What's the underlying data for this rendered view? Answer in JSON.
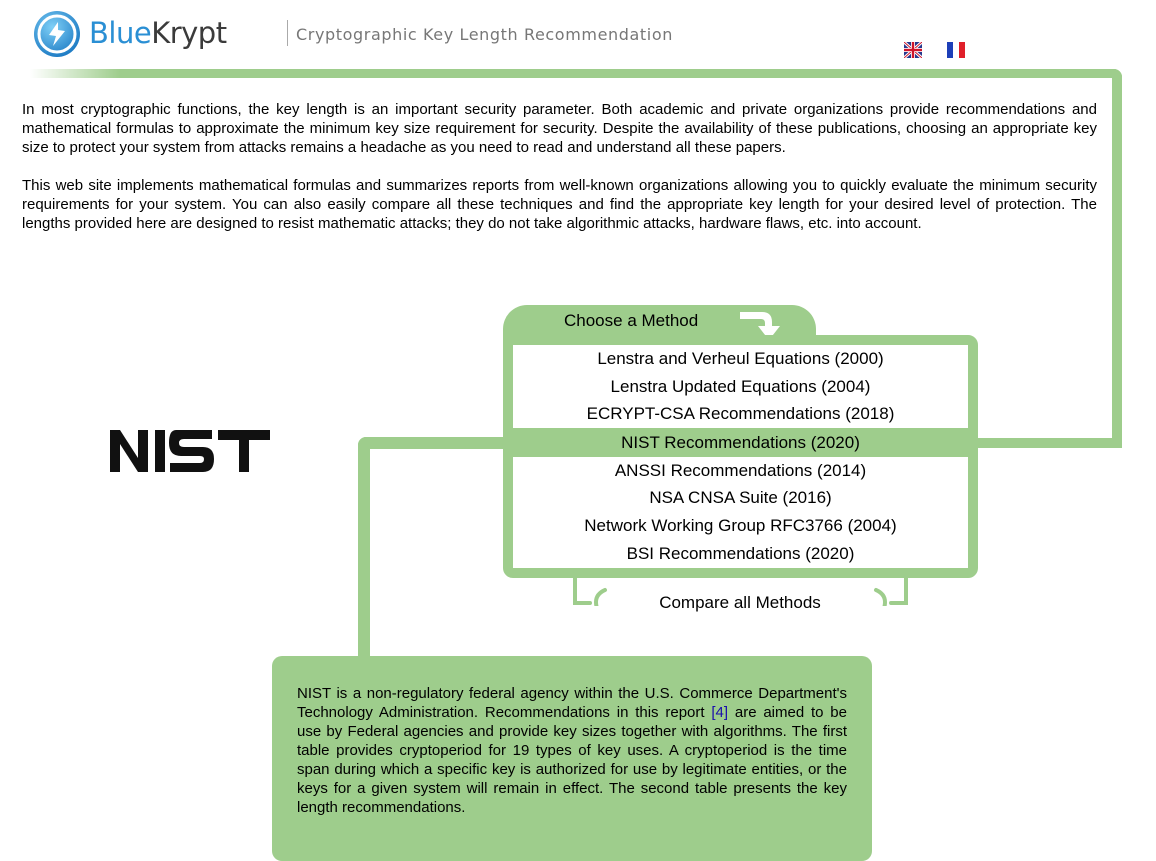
{
  "header": {
    "brand_part1": "Blue",
    "brand_part2": "Krypt",
    "tagline": "Cryptographic Key Length Recommendation"
  },
  "languages": [
    {
      "code": "en",
      "icon": "uk-flag-icon"
    },
    {
      "code": "fr",
      "icon": "france-flag-icon"
    }
  ],
  "intro": {
    "paragraph1": "In most cryptographic functions, the key length is an important security parameter. Both academic and private organizations provide recommendations and mathematical formulas to approximate the minimum key size requirement for security. Despite the availability of these publications, choosing an appropriate key size to protect your system from attacks remains a headache as you need to read and understand all these papers.",
    "paragraph2": "This web site implements mathematical formulas and summarizes reports from well-known organizations allowing you to quickly evaluate the minimum security requirements for your system. You can also easily compare all these techniques and find the appropriate key length for your desired level of protection. The lengths provided here are designed to resist mathematic attacks; they do not take algorithmic attacks, hardware flaws, etc. into account."
  },
  "selected_logo": {
    "text": "NIST"
  },
  "methods": {
    "title": "Choose a Method",
    "items": [
      {
        "label": "Lenstra and Verheul Equations (2000)",
        "active": false
      },
      {
        "label": "Lenstra Updated Equations (2004)",
        "active": false
      },
      {
        "label": "ECRYPT-CSA Recommendations (2018)",
        "active": false
      },
      {
        "label": "NIST Recommendations (2020)",
        "active": true
      },
      {
        "label": "ANSSI Recommendations (2014)",
        "active": false
      },
      {
        "label": "NSA CNSA Suite (2016)",
        "active": false
      },
      {
        "label": "Network Working Group RFC3766 (2004)",
        "active": false
      },
      {
        "label": "BSI Recommendations (2020)",
        "active": false
      }
    ],
    "compare_label": "Compare all Methods"
  },
  "description": {
    "before_link": "NIST is a non-regulatory federal agency within the U.S. Commerce Department's Technology Administration. Recommendations in this report ",
    "link_text": "[4]",
    "after_link": " are aimed to be use by Federal agencies and provide key sizes together with algorithms. The first table provides cryptoperiod for 19 types of key uses. A cryptoperiod is the time span during which a specific key is authorized for use by legitimate entities, or the keys for a given system will remain in effect. The second table presents the key length recommendations."
  },
  "colors": {
    "accent_green": "#9ecd8c",
    "brand_blue": "#2a8fd4",
    "brand_dark": "#3b3b3b",
    "link_blue": "#1a0dab"
  }
}
